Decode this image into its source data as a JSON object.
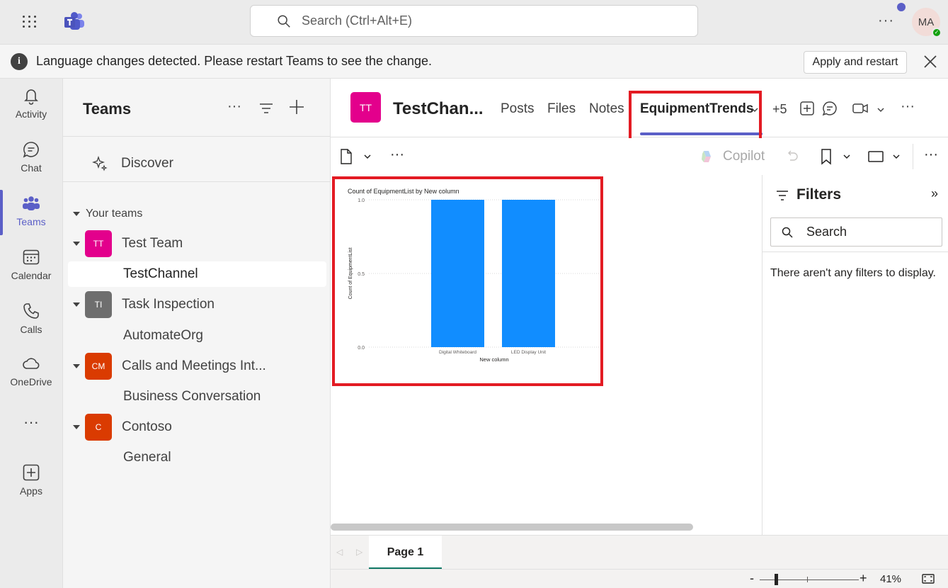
{
  "titlebar": {
    "search_placeholder": "Search (Ctrl+Alt+E)",
    "avatar_initials": "MA"
  },
  "notice": {
    "message": "Language changes detected. Please restart Teams to see the change.",
    "apply_label": "Apply and restart"
  },
  "rail": {
    "items": [
      {
        "label": "Activity",
        "icon": "bell-icon"
      },
      {
        "label": "Chat",
        "icon": "chat-icon"
      },
      {
        "label": "Teams",
        "icon": "teams-icon"
      },
      {
        "label": "Calendar",
        "icon": "calendar-icon"
      },
      {
        "label": "Calls",
        "icon": "phone-icon"
      },
      {
        "label": "OneDrive",
        "icon": "cloud-icon"
      },
      {
        "label": "Apps",
        "icon": "apps-icon"
      }
    ]
  },
  "teams_panel": {
    "title": "Teams",
    "discover": "Discover",
    "your_teams": "Your teams",
    "teams": [
      {
        "initials": "TT",
        "name": "Test Team",
        "color": "#e3008c",
        "channel": "TestChannel"
      },
      {
        "initials": "TI",
        "name": "Task Inspection",
        "color": "#6e6e6e",
        "channel": "AutomateOrg"
      },
      {
        "initials": "CM",
        "name": "Calls and Meetings Int...",
        "color": "#da3b01",
        "channel": "Business Conversation"
      },
      {
        "initials": "C",
        "name": "Contoso",
        "color": "#da3b01",
        "channel": "General"
      }
    ]
  },
  "channel_header": {
    "initials": "TT",
    "name": "TestChan...",
    "tabs": [
      "Posts",
      "Files",
      "Notes",
      "EquipmentTrends"
    ],
    "active_tab": "EquipmentTrends",
    "more_tabs": "+5"
  },
  "toolbar": {
    "copilot_label": "Copilot"
  },
  "chart_data": {
    "type": "bar",
    "title": "Count of EquipmentList by New column",
    "xlabel": "New column",
    "ylabel": "Count of EquipmentList",
    "categories": [
      "Digital Whiteboard",
      "LED Display Unit"
    ],
    "values": [
      1,
      1
    ],
    "ylim": [
      0,
      1
    ],
    "yticks": [
      "0.0",
      "0.5",
      "1.0"
    ],
    "bar_color": "#118dff",
    "grid": true
  },
  "filters": {
    "title": "Filters",
    "search_placeholder": "Search",
    "empty_message": "There aren't any filters to display."
  },
  "pages": {
    "active": "Page 1"
  },
  "status": {
    "zoom": "41%"
  }
}
